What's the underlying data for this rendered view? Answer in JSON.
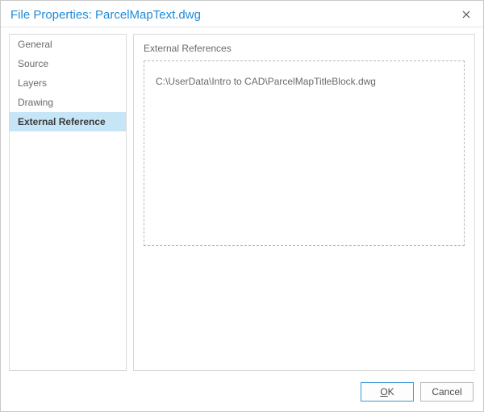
{
  "titlebar": {
    "title": "File Properties: ParcelMapText.dwg"
  },
  "sidebar": {
    "items": [
      {
        "label": "General"
      },
      {
        "label": "Source"
      },
      {
        "label": "Layers"
      },
      {
        "label": "Drawing"
      },
      {
        "label": "External Reference"
      }
    ],
    "active_index": 4
  },
  "content": {
    "section_title": "External References",
    "references": [
      "C:\\UserData\\Intro to CAD\\ParcelMapTitleBlock.dwg"
    ]
  },
  "footer": {
    "ok_label": "OK",
    "cancel_label": "Cancel"
  }
}
